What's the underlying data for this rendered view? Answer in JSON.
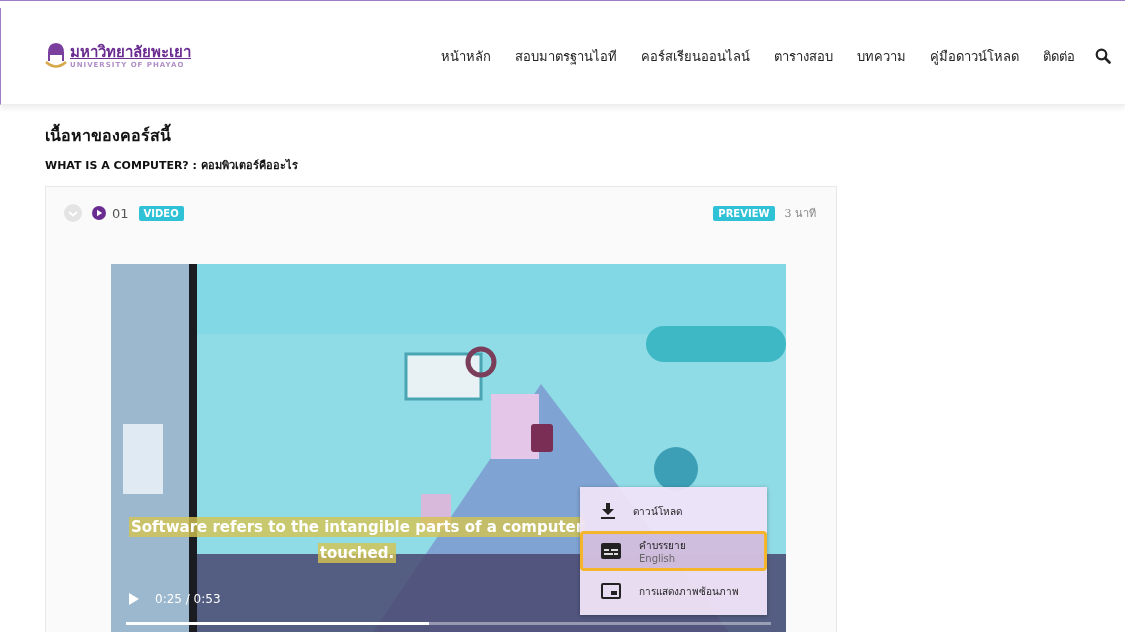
{
  "header": {
    "logo": {
      "name": "มหาวิทยาลัยพะเยา",
      "subtitle": "UNIVERSITY OF PHAYAO"
    },
    "nav": [
      {
        "label": "หน้าหลัก"
      },
      {
        "label": "สอบมาตรฐานไอที"
      },
      {
        "label": "คอร์สเรียนออนไลน์"
      },
      {
        "label": "ตารางสอบ"
      },
      {
        "label": "บทความ"
      },
      {
        "label": "คู่มือดาวน์โหลด"
      },
      {
        "label": "ติดต่อ"
      }
    ]
  },
  "section_title": "เนื้อหาของคอร์สนี้",
  "lesson_title": "WHAT IS A COMPUTER? : คอมพิวเตอร์คืออะไร",
  "lesson": {
    "completed": false,
    "number": "01",
    "type_badge": "VIDEO",
    "preview_badge": "PREVIEW",
    "duration": "3 นาที"
  },
  "player": {
    "kind": "picture",
    "caption_lines": [
      "Software refers to the intangible parts of a computer",
      "touched."
    ],
    "time": "0:25 / 0:53",
    "progress": {
      "level": 0.47
    },
    "menu": [
      {
        "kind": "download",
        "label": "ดาวน์โหลด",
        "selected": false
      },
      {
        "kind": "captions",
        "label": "คำบรรยาย",
        "sublabel": "English",
        "selected": true
      },
      {
        "kind": "pip",
        "label": "การแสดงภาพซ้อนภาพ",
        "selected": false
      }
    ]
  }
}
